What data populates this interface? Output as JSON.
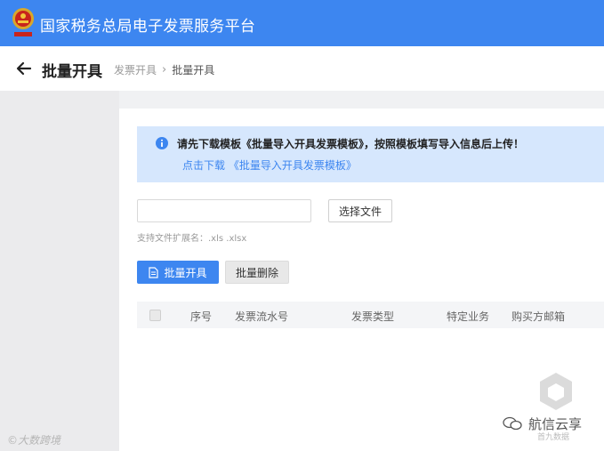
{
  "topbar": {
    "title": "国家税务总局电子发票服务平台",
    "emblem_icon": "national-emblem-icon",
    "bg_color": "#3d86f0"
  },
  "header": {
    "back_icon": "arrow-left-icon",
    "page_title": "批量开具",
    "breadcrumb": {
      "parent": "发票开具",
      "separator": "›",
      "current": "批量开具"
    }
  },
  "notice": {
    "icon": "info-icon",
    "text": "请先下载模板《批量导入开具发票模板》，按照模板填写导入信息后上传！",
    "link_text": "点击下载 《批量导入开具发票模板》",
    "bg_color": "#d6e7fd"
  },
  "upload": {
    "file_value": "",
    "choose_button": "选择文件",
    "extensions_hint": "支持文件扩展名：.xls .xlsx"
  },
  "actions": {
    "batch_issue": "批量开具",
    "batch_issue_icon": "document-icon",
    "batch_delete": "批量删除"
  },
  "table": {
    "columns": [
      "序号",
      "发票流水号",
      "发票类型",
      "特定业务",
      "购买方邮箱"
    ],
    "rows": []
  },
  "watermarks": {
    "channel": "航信云享",
    "source": "首九数据",
    "left": "©大数跨境"
  }
}
